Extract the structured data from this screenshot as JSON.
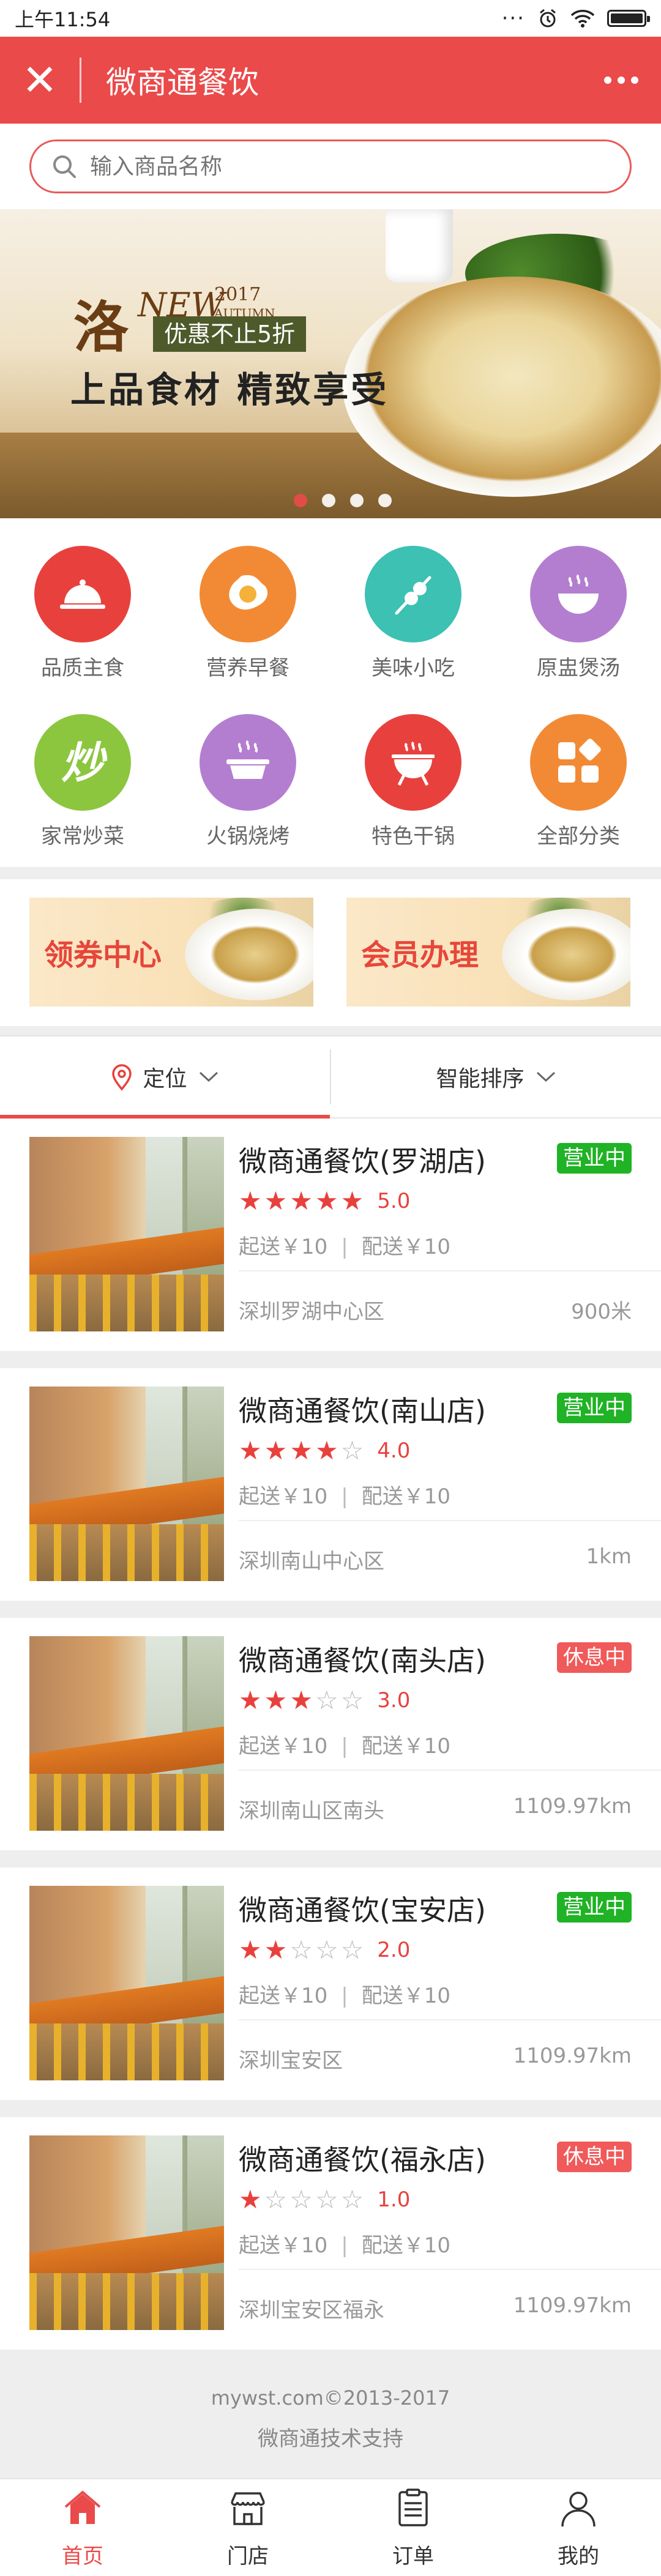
{
  "statusbar": {
    "time": "上午11:54",
    "dots": "···",
    "battery_level": 0.9
  },
  "titlebar": {
    "close": "✕",
    "title": "微商通餐饮"
  },
  "search": {
    "placeholder": "输入商品名称"
  },
  "banner": {
    "brand_char": "洛",
    "new": "NEW",
    "year": "2017",
    "season": "AUTUMN",
    "tag": "优惠不止5折",
    "slogan": "上品食材 精致享受",
    "active_slide": 1,
    "slide_count": 4
  },
  "categories": [
    {
      "label": "品质主食",
      "color": "#e8413d",
      "icon": "dome-cloche-icon"
    },
    {
      "label": "营养早餐",
      "color": "#f28a35",
      "icon": "fried-egg-icon"
    },
    {
      "label": "美味小吃",
      "color": "#3cc1b2",
      "icon": "skewer-icon"
    },
    {
      "label": "原盅煲汤",
      "color": "#b47ed0",
      "icon": "soup-bowl-icon"
    },
    {
      "label": "家常炒菜",
      "color": "#8cc63f",
      "icon": "chao-character-icon"
    },
    {
      "label": "火锅烧烤",
      "color": "#b47ed0",
      "icon": "hotpot-icon"
    },
    {
      "label": "特色干锅",
      "color": "#e8413d",
      "icon": "grill-icon"
    },
    {
      "label": "全部分类",
      "color": "#f28a35",
      "icon": "grid-squares-icon"
    }
  ],
  "promos": [
    {
      "label": "领券中心"
    },
    {
      "label": "会员办理"
    }
  ],
  "filters": {
    "location": "定位",
    "sort": "智能排序"
  },
  "stores": [
    {
      "name": "微商通餐饮(罗湖店)",
      "status": "营业中",
      "open": true,
      "stars": 5,
      "rating": "5.0",
      "min_order": "起送￥10",
      "delivery": "配送￥10",
      "area": "深圳罗湖中心区",
      "distance": "900米"
    },
    {
      "name": "微商通餐饮(南山店)",
      "status": "营业中",
      "open": true,
      "stars": 4,
      "rating": "4.0",
      "min_order": "起送￥10",
      "delivery": "配送￥10",
      "area": "深圳南山中心区",
      "distance": "1km"
    },
    {
      "name": "微商通餐饮(南头店)",
      "status": "休息中",
      "open": false,
      "stars": 3,
      "rating": "3.0",
      "min_order": "起送￥10",
      "delivery": "配送￥10",
      "area": "深圳南山区南头",
      "distance": "1109.97km"
    },
    {
      "name": "微商通餐饮(宝安店)",
      "status": "营业中",
      "open": true,
      "stars": 2,
      "rating": "2.0",
      "min_order": "起送￥10",
      "delivery": "配送￥10",
      "area": "深圳宝安区",
      "distance": "1109.97km"
    },
    {
      "name": "微商通餐饮(福永店)",
      "status": "休息中",
      "open": false,
      "stars": 1,
      "rating": "1.0",
      "min_order": "起送￥10",
      "delivery": "配送￥10",
      "area": "深圳宝安区福永",
      "distance": "1109.97km"
    }
  ],
  "footer": {
    "copyright": "mywst.com©2013-2017",
    "support": "微商通技术支持"
  },
  "tabbar": [
    {
      "label": "首页",
      "icon": "home-icon",
      "active": true
    },
    {
      "label": "门店",
      "icon": "store-icon",
      "active": false
    },
    {
      "label": "订单",
      "icon": "order-list-icon",
      "active": false
    },
    {
      "label": "我的",
      "icon": "user-icon",
      "active": false
    }
  ],
  "colors": {
    "brand": "#ea4a4a",
    "open": "#1fb325",
    "rest": "#f05a5a",
    "star": "#e8413d"
  }
}
